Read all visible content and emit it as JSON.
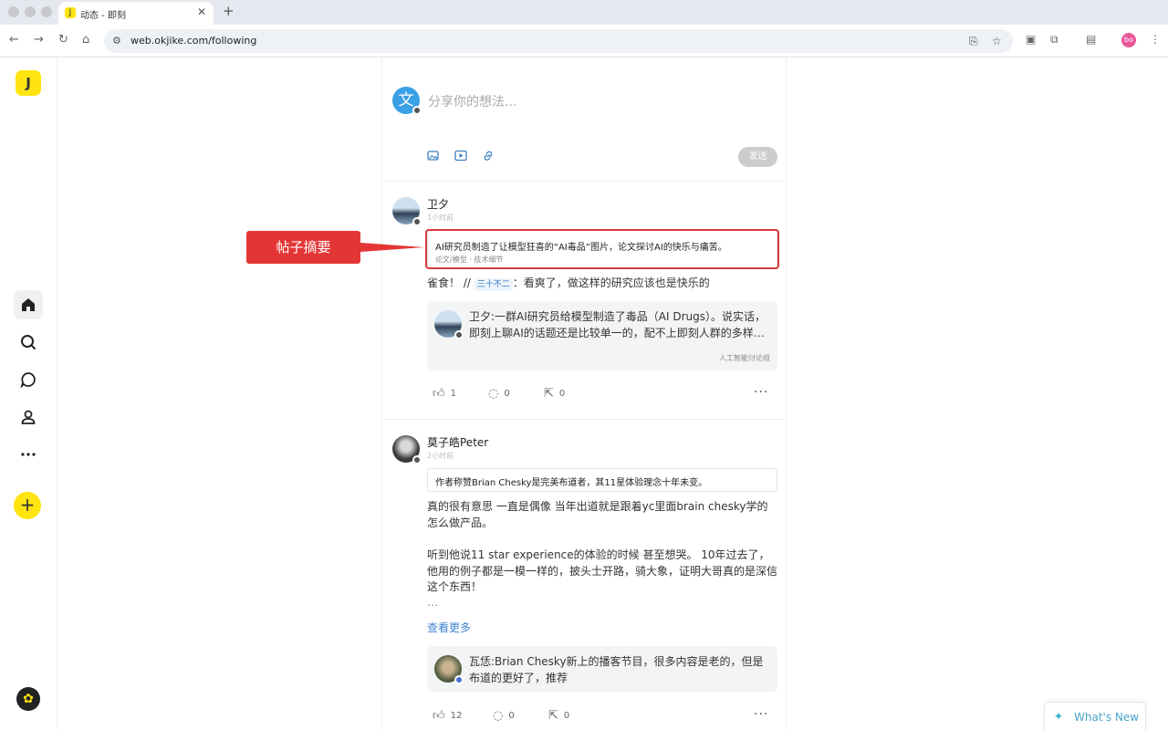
{
  "browser": {
    "tab_title": "动态 - 即刻",
    "url": "web.okjike.com/following",
    "profile_initials": "bo",
    "tab_close": "✕",
    "new_tab": "+"
  },
  "sidebar": {
    "logo": "J",
    "items": [
      {
        "icon": "home-icon"
      },
      {
        "icon": "search-icon"
      },
      {
        "icon": "chat-icon"
      },
      {
        "icon": "user-icon"
      },
      {
        "icon": "more-icon"
      }
    ]
  },
  "composer": {
    "avatar_char": "文",
    "placeholder": "分享你的想法...",
    "send_label": "发送"
  },
  "annotation": {
    "label": "帖子摘要",
    "color": "#e43535"
  },
  "posts": [
    {
      "name": "卫夕",
      "time": "1小时前",
      "summary": "AI研究员制造了让模型狂喜的“AI毒品”图片，论文探讨AI的快乐与痛苦。",
      "summary_tags": "论文/模型 · 技术细节",
      "body_prefix": "雀食！ // ",
      "mention": "三十不二",
      "body_suffix": "：看爽了，做这样的研究应该也是快乐的",
      "quote_text": "卫夕:一群AI研究员给模型制造了毒品（AI Drugs）。说实话，即刻上聊AI的话题还是比较单一的，配不上即刻人群的多样…",
      "quote_group": "人工智能讨论组",
      "likes": "1",
      "comments": "0",
      "shares": "0"
    },
    {
      "name": "莫子皓Peter",
      "time": "2小时前",
      "summary": "作者称赞Brian Chesky是完美布道者，其11星体验理念十年未变。",
      "body_p1": "真的很有意思 一直是偶像 当年出道就是跟着yc里面brain chesky学的怎么做产品。",
      "body_p2": "听到他说11 star experience的体验的时候 甚至想哭。 10年过去了，他用的例子都是一模一样的，披头士开路，骑大象，证明大哥真的是深信这个东西！",
      "body_ellipsis": "…",
      "see_more": "查看更多",
      "quote_text": "瓦恁:Brian Chesky新上的播客节目，很多内容是老的，但是布道的更好了，推荐",
      "likes": "12",
      "comments": "0",
      "shares": "0"
    }
  ],
  "whats_new": "What's New"
}
